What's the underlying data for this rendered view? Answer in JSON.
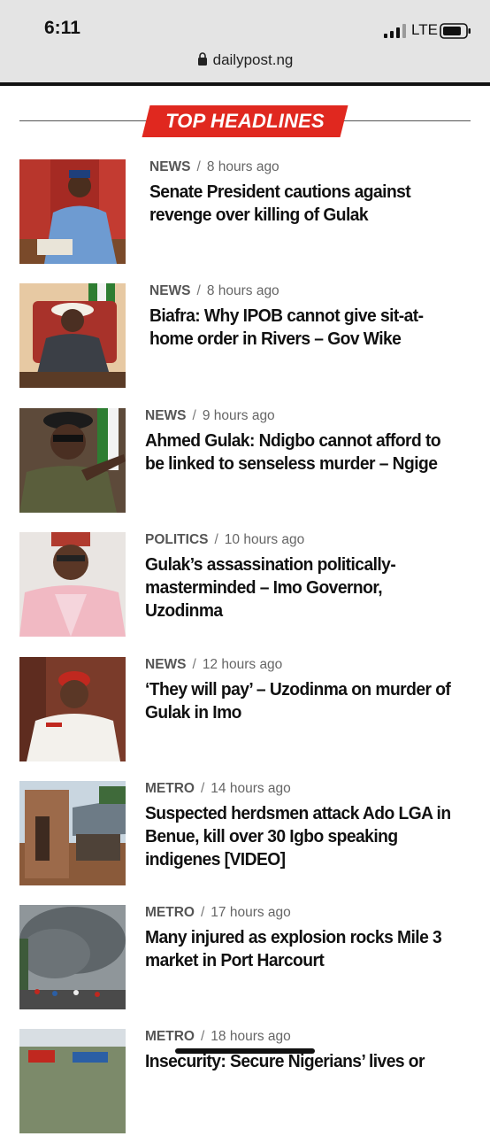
{
  "status": {
    "time": "6:11",
    "network": "LTE",
    "url": "dailypost.ng"
  },
  "section": {
    "title": "TOP HEADLINES",
    "accent_color": "#e0281f"
  },
  "articles": [
    {
      "category": "NEWS",
      "time": "8 hours ago",
      "title": "Senate President cautions against revenge over killing of Gulak",
      "thumb_icon": "man-seated-red-chairs-photo"
    },
    {
      "category": "NEWS",
      "time": "8 hours ago",
      "title": "Biafra: Why IPOB cannot give sit-at-home order in Rivers – Gov Wike",
      "thumb_icon": "man-white-hat-desk-photo"
    },
    {
      "category": "NEWS",
      "time": "9 hours ago",
      "title": "Ahmed Gulak: Ndigbo cannot afford to be linked to senseless murder – Ngige",
      "thumb_icon": "man-black-cap-pointing-photo"
    },
    {
      "category": "POLITICS",
      "time": "10 hours ago",
      "title": "Gulak’s assassination politically-masterminded – Imo Governor, Uzodinma",
      "thumb_icon": "man-red-cap-portrait-photo"
    },
    {
      "category": "NEWS",
      "time": "12 hours ago",
      "title": "‘They will pay’ – Uzodinma on murder of Gulak in Imo",
      "thumb_icon": "man-red-cap-white-robe-photo"
    },
    {
      "category": "METRO",
      "time": "14 hours ago",
      "title": "Suspected herdsmen attack Ado LGA in Benue, kill over 30 Igbo speaking indigenes [VIDEO]",
      "thumb_icon": "damaged-building-photo"
    },
    {
      "category": "METRO",
      "time": "17 hours ago",
      "title": "Many injured as explosion rocks Mile 3 market in Port Harcourt",
      "thumb_icon": "smoke-crowd-photo"
    },
    {
      "category": "METRO",
      "time": "18 hours ago",
      "title": "Insecurity: Secure Nigerians’ lives or",
      "thumb_icon": "street-scene-photo"
    }
  ]
}
